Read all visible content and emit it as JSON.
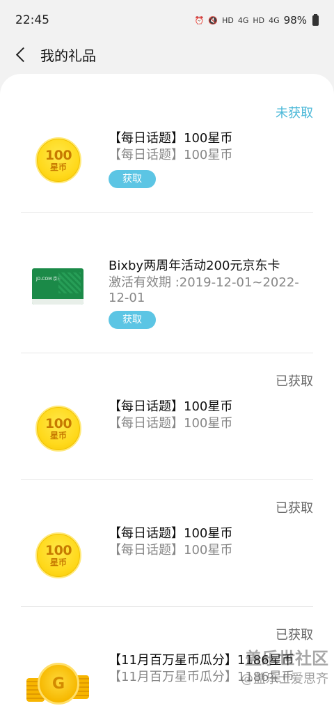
{
  "status_bar": {
    "time": "22:45",
    "icons": [
      "alarm-icon",
      "mute-icon",
      "hd-icon",
      "4g-signal-icon",
      "hd-icon",
      "4g-signal-icon"
    ],
    "hd1": "HD",
    "net1": "4G",
    "hd2": "HD",
    "net2": "4G",
    "battery": "98%"
  },
  "header": {
    "title": "我的礼品"
  },
  "gifts": [
    {
      "status": "未获取",
      "title": "【每日话题】100星币",
      "desc": "【每日话题】100星币",
      "button": "获取",
      "coin_num": "100",
      "coin_unit": "星币"
    },
    {
      "status": "",
      "title": "Bixby两周年活动200元京东卡",
      "desc": "激活有效期 :2019-12-01~2022-12-01",
      "button": "获取",
      "card_logo": "JD.COM 京东"
    },
    {
      "status": "已获取",
      "title": "【每日话题】100星币",
      "desc": "【每日话题】100星币",
      "coin_num": "100",
      "coin_unit": "星币"
    },
    {
      "status": "已获取",
      "title": "【每日话题】100星币",
      "desc": "【每日话题】100星币",
      "coin_num": "100",
      "coin_unit": "星币"
    },
    {
      "status": "已获取",
      "title": "【11月百万星币瓜分】1186星币",
      "desc": "【11月百万星币瓜分】1186星币",
      "coin_letter": "G"
    }
  ],
  "watermark": {
    "line1": "盖乐世社区",
    "line2": "@盖乐士爱思齐"
  },
  "colors": {
    "accent": "#4bb8d8",
    "button": "#5cc5e4",
    "coin": "#ffd91c",
    "jd_card": "#1b8a48"
  }
}
